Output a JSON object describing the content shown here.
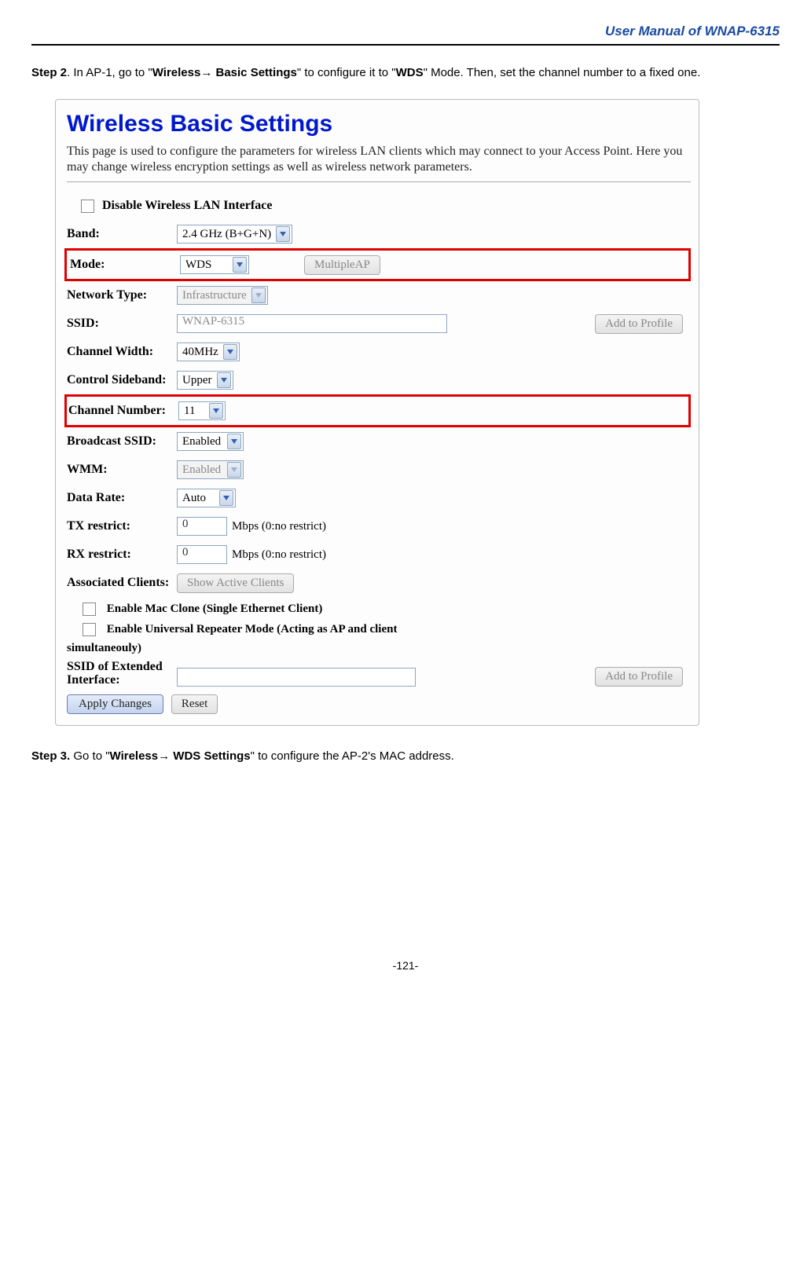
{
  "header": {
    "title": "User Manual of WNAP-6315"
  },
  "step2": {
    "prefix": "Step 2",
    "text_a": ". In AP-1, go to \"",
    "nav_bold": "Wireless",
    "arrow": "→",
    "nav_bold2": " Basic Settings",
    "text_b": "\" to configure it to \"",
    "wds": "WDS",
    "text_c": "\" Mode. Then, set the channel number to a fixed one."
  },
  "panel": {
    "title": "Wireless Basic Settings",
    "desc": "This page is used to configure the parameters for wireless LAN clients which may connect to your Access Point. Here you may change wireless encryption settings as well as wireless network parameters.",
    "disable_label": "Disable Wireless LAN Interface",
    "band_label": "Band:",
    "band_value": "2.4 GHz (B+G+N)",
    "mode_label": "Mode:",
    "mode_value": "WDS",
    "multiple_ap_btn": "MultipleAP",
    "network_type_label": "Network Type:",
    "network_type_value": "Infrastructure",
    "ssid_label": "SSID:",
    "ssid_value": "WNAP-6315",
    "add_to_profile_btn": "Add to Profile",
    "channel_width_label": "Channel Width:",
    "channel_width_value": "40MHz",
    "control_sideband_label": "Control Sideband:",
    "control_sideband_value": "Upper",
    "channel_number_label": "Channel Number:",
    "channel_number_value": "11",
    "broadcast_ssid_label": "Broadcast SSID:",
    "broadcast_ssid_value": "Enabled",
    "wmm_label": "WMM:",
    "wmm_value": "Enabled",
    "data_rate_label": "Data Rate:",
    "data_rate_value": "Auto",
    "tx_restrict_label": "TX restrict:",
    "tx_restrict_value": "0",
    "rx_restrict_label": "RX restrict:",
    "rx_restrict_value": "0",
    "mbps_text": "Mbps (0:no restrict)",
    "assoc_clients_label": "Associated Clients:",
    "show_active_btn": "Show Active Clients",
    "mac_clone_label": "Enable Mac Clone (Single Ethernet Client)",
    "universal_rep_label": "Enable Universal Repeater Mode (Acting as AP and client simultaneouly)",
    "universal_rep_line1": "Enable Universal Repeater Mode (Acting as AP and client",
    "universal_rep_line2": "simultaneouly)",
    "ssid_ext_label": "SSID of Extended Interface:",
    "ssid_ext_label_l1": "SSID of Extended",
    "ssid_ext_label_l2": "Interface:",
    "apply_btn": "Apply Changes",
    "reset_btn": "Reset"
  },
  "step3": {
    "prefix": "Step 3.",
    "text_a": " Go to \"",
    "nav_bold": "Wireless",
    "arrow": "→",
    "nav_bold2": " WDS Settings",
    "text_b": "\" to configure the AP-2's MAC address."
  },
  "page_number": "-121-"
}
